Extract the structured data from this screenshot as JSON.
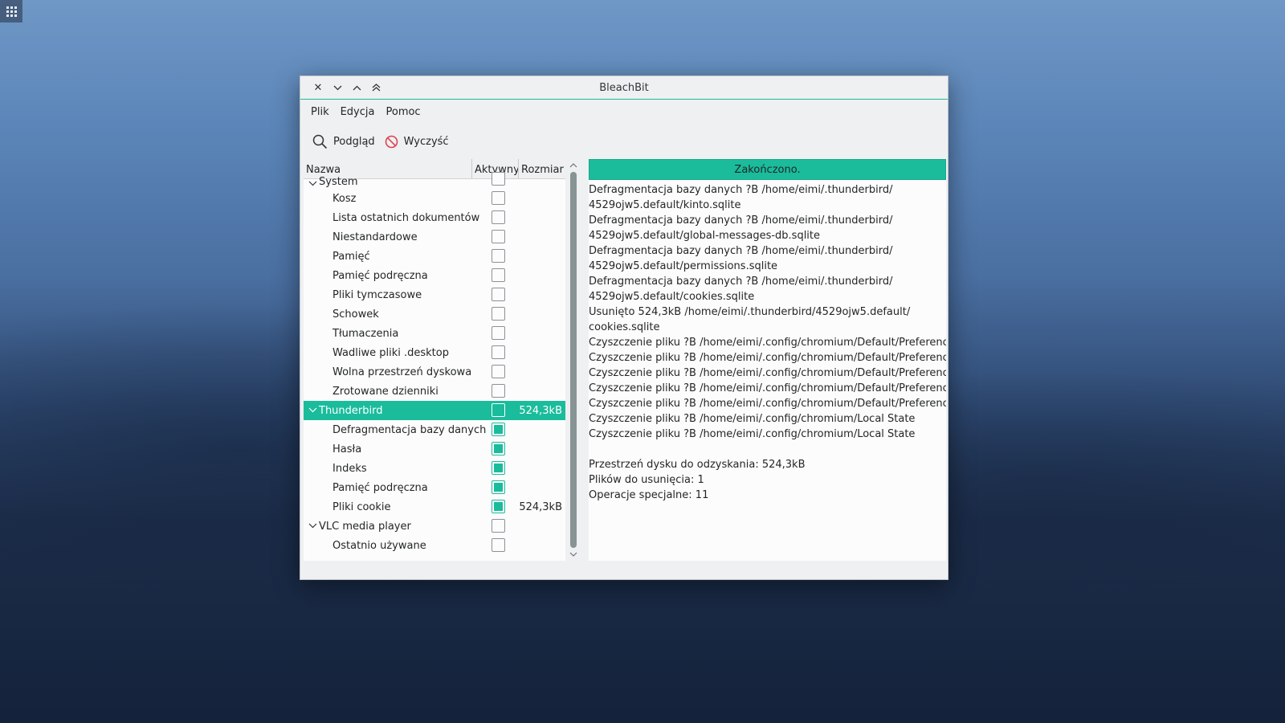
{
  "window": {
    "title": "BleachBit",
    "controls": [
      "close-icon",
      "minimize-icon",
      "maximize-icon",
      "keep-above-icon"
    ]
  },
  "menu": {
    "items": [
      "Plik",
      "Edycja",
      "Pomoc"
    ]
  },
  "toolbar": {
    "preview_label": "Podgląd",
    "clean_label": "Wyczyść"
  },
  "tree": {
    "columns": [
      "Nazwa",
      "Aktywny",
      "Rozmiar"
    ],
    "rows": [
      {
        "name": "System",
        "level": 0,
        "expanded": true,
        "checked": false,
        "size": ""
      },
      {
        "name": "Kosz",
        "level": 1,
        "checked": false,
        "size": ""
      },
      {
        "name": "Lista ostatnich dokumentów",
        "level": 1,
        "checked": false,
        "size": ""
      },
      {
        "name": "Niestandardowe",
        "level": 1,
        "checked": false,
        "size": ""
      },
      {
        "name": "Pamięć",
        "level": 1,
        "checked": false,
        "size": ""
      },
      {
        "name": "Pamięć podręczna",
        "level": 1,
        "checked": false,
        "size": ""
      },
      {
        "name": "Pliki tymczasowe",
        "level": 1,
        "checked": false,
        "size": ""
      },
      {
        "name": "Schowek",
        "level": 1,
        "checked": false,
        "size": ""
      },
      {
        "name": "Tłumaczenia",
        "level": 1,
        "checked": false,
        "size": ""
      },
      {
        "name": "Wadliwe pliki .desktop",
        "level": 1,
        "checked": false,
        "size": ""
      },
      {
        "name": "Wolna przestrzeń dyskowa",
        "level": 1,
        "checked": false,
        "size": ""
      },
      {
        "name": "Zrotowane dzienniki",
        "level": 1,
        "checked": false,
        "size": ""
      },
      {
        "name": "Thunderbird",
        "level": 0,
        "expanded": true,
        "checked": false,
        "selected": true,
        "size": "524,3kB"
      },
      {
        "name": "Defragmentacja bazy danych",
        "level": 1,
        "checked": true,
        "size": ""
      },
      {
        "name": "Hasła",
        "level": 1,
        "checked": true,
        "size": ""
      },
      {
        "name": "Indeks",
        "level": 1,
        "checked": true,
        "size": ""
      },
      {
        "name": "Pamięć podręczna",
        "level": 1,
        "checked": true,
        "size": ""
      },
      {
        "name": "Pliki cookie",
        "level": 1,
        "checked": true,
        "size": "524,3kB"
      },
      {
        "name": "VLC media player",
        "level": 0,
        "expanded": true,
        "checked": false,
        "size": ""
      },
      {
        "name": "Ostatnio używane",
        "level": 1,
        "checked": false,
        "size": ""
      }
    ]
  },
  "log": {
    "status": "Zakończono.",
    "progress": 1.0,
    "lines": [
      "Defragmentacja bazy danych ?B /home/eimi/.thunderbird/",
      "4529ojw5.default/kinto.sqlite",
      "Defragmentacja bazy danych ?B /home/eimi/.thunderbird/",
      "4529ojw5.default/global-messages-db.sqlite",
      "Defragmentacja bazy danych ?B /home/eimi/.thunderbird/",
      "4529ojw5.default/permissions.sqlite",
      "Defragmentacja bazy danych ?B /home/eimi/.thunderbird/",
      "4529ojw5.default/cookies.sqlite",
      "Usunięto 524,3kB /home/eimi/.thunderbird/4529ojw5.default/",
      "cookies.sqlite",
      "Czyszczenie pliku ?B /home/eimi/.config/chromium/Default/Preferences",
      "Czyszczenie pliku ?B /home/eimi/.config/chromium/Default/Preferences",
      "Czyszczenie pliku ?B /home/eimi/.config/chromium/Default/Preferences",
      "Czyszczenie pliku ?B /home/eimi/.config/chromium/Default/Preferences",
      "Czyszczenie pliku ?B /home/eimi/.config/chromium/Default/Preferences",
      "Czyszczenie pliku ?B /home/eimi/.config/chromium/Local State",
      "Czyszczenie pliku ?B /home/eimi/.config/chromium/Local State",
      "",
      "Przestrzeń dysku do odzyskania: 524,3kB",
      "Plików do usunięcia: 1",
      "Operacje specjalne: 11"
    ]
  },
  "colors": {
    "accent": "#1abc9c",
    "window_bg": "#eff0f1",
    "text": "#232627"
  }
}
